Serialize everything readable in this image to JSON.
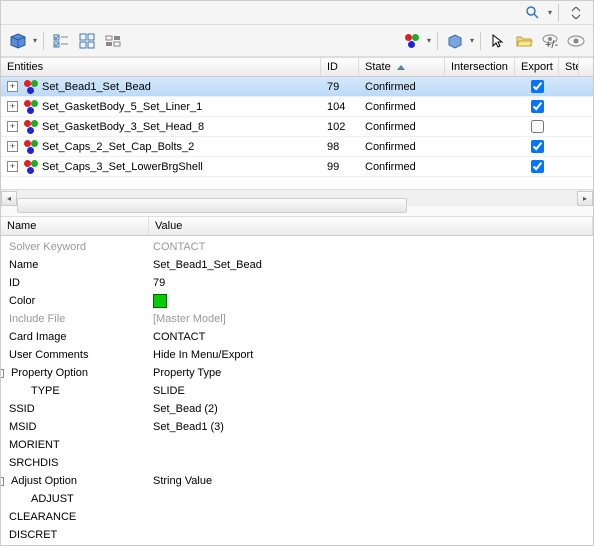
{
  "columns": {
    "entities": "Entities",
    "id": "ID",
    "state": "State",
    "intersection": "Intersection",
    "export": "Export",
    "ste": "Ste"
  },
  "rows": [
    {
      "name": "Set_Bead1_Set_Bead",
      "id": "79",
      "state": "Confirmed",
      "export": true,
      "selected": true
    },
    {
      "name": "Set_GasketBody_5_Set_Liner_1",
      "id": "104",
      "state": "Confirmed",
      "export": true,
      "selected": false
    },
    {
      "name": "Set_GasketBody_3_Set_Head_8",
      "id": "102",
      "state": "Confirmed",
      "export": false,
      "selected": false
    },
    {
      "name": "Set_Caps_2_Set_Cap_Bolts_2",
      "id": "98",
      "state": "Confirmed",
      "export": true,
      "selected": false
    },
    {
      "name": "Set_Caps_3_Set_LowerBrgShell",
      "id": "99",
      "state": "Confirmed",
      "export": true,
      "selected": false
    }
  ],
  "propHeader": {
    "name": "Name",
    "value": "Value"
  },
  "props": [
    {
      "name": "Solver Keyword",
      "value": "CONTACT",
      "disabled": true
    },
    {
      "name": "Name",
      "value": "Set_Bead1_Set_Bead"
    },
    {
      "name": "ID",
      "value": "79"
    },
    {
      "name": "Color",
      "value": "",
      "color": true
    },
    {
      "name": "Include File",
      "value": "[Master Model]",
      "disabled": true
    },
    {
      "name": "Card Image",
      "value": "CONTACT"
    },
    {
      "name": "User Comments",
      "value": "Hide In Menu/Export"
    },
    {
      "name": "Property Option",
      "value": "Property Type",
      "expander": "-"
    },
    {
      "name": "TYPE",
      "value": "SLIDE",
      "indent": 1
    },
    {
      "name": "SSID",
      "value": "Set_Bead (2)"
    },
    {
      "name": "MSID",
      "value": "Set_Bead1 (3)"
    },
    {
      "name": "MORIENT",
      "value": ""
    },
    {
      "name": "SRCHDIS",
      "value": ""
    },
    {
      "name": "Adjust Option",
      "value": "String Value",
      "expander": "-"
    },
    {
      "name": "ADJUST",
      "value": "",
      "indent": 1
    },
    {
      "name": "CLEARANCE",
      "value": ""
    },
    {
      "name": "DISCRET",
      "value": ""
    }
  ]
}
